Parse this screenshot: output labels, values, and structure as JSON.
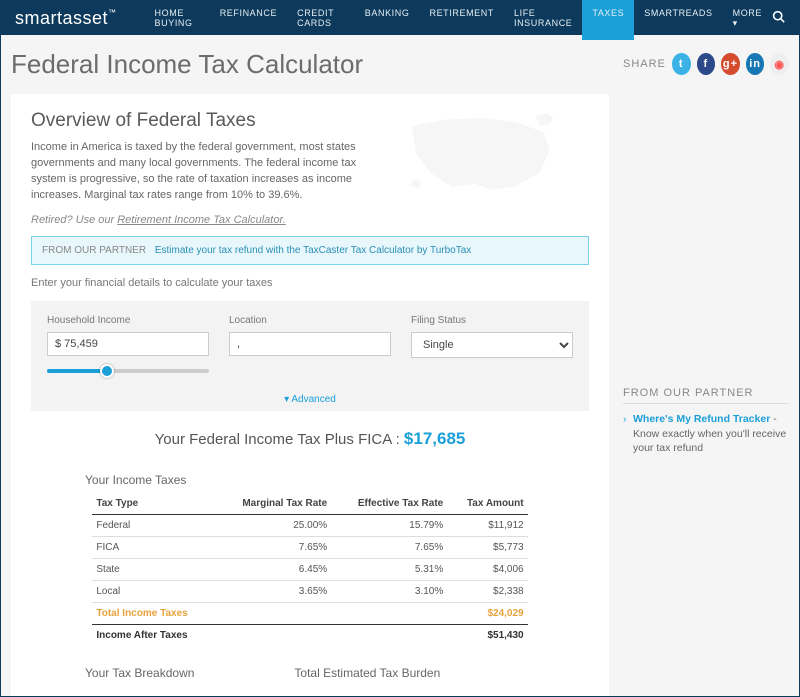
{
  "logo": {
    "a": "smart",
    "b": "asset"
  },
  "nav": [
    "HOME BUYING",
    "REFINANCE",
    "CREDIT CARDS",
    "BANKING",
    "RETIREMENT",
    "LIFE INSURANCE",
    "TAXES",
    "SMARTREADS",
    "MORE ▾"
  ],
  "title": "Federal Income Tax Calculator",
  "overview": {
    "heading": "Overview of Federal Taxes",
    "body": "Income in America is taxed by the federal government, most states governments and many local governments. The federal income tax system is progressive, so the rate of taxation increases as income increases. Marginal tax rates range from 10% to 39.6%."
  },
  "retired": {
    "pre": "Retired? Use our ",
    "link": "Retirement Income Tax Calculator."
  },
  "partner": {
    "label": "FROM OUR PARTNER",
    "text": "Estimate your tax refund with the TaxCaster Tax Calculator by TurboTax"
  },
  "prompt": "Enter your financial details to calculate your taxes",
  "fields": {
    "income_label": "Household Income",
    "income_value": "$ 75,459",
    "location_label": "Location",
    "location_value": ",",
    "filing_label": "Filing Status",
    "filing_value": "Single"
  },
  "advanced": "▾ Advanced",
  "result": {
    "text": "Your Federal Income Tax Plus FICA :",
    "amount": "$17,685"
  },
  "table": {
    "title": "Your Income Taxes",
    "headers": [
      "Tax Type",
      "Marginal Tax Rate",
      "Effective Tax Rate",
      "Tax Amount"
    ],
    "rows": [
      [
        "Federal",
        "25.00%",
        "15.79%",
        "$11,912"
      ],
      [
        "FICA",
        "7.65%",
        "7.65%",
        "$5,773"
      ],
      [
        "State",
        "6.45%",
        "5.31%",
        "$4,006"
      ],
      [
        "Local",
        "3.65%",
        "3.10%",
        "$2,338"
      ]
    ],
    "total": [
      "Total Income Taxes",
      "",
      "",
      "$24,029"
    ],
    "after": [
      "Income After Taxes",
      "",
      "",
      "$51,430"
    ]
  },
  "bottom": [
    "Your Tax Breakdown",
    "Total Estimated Tax Burden"
  ],
  "share": {
    "label": "SHARE"
  },
  "sidepartner": {
    "heading": "FROM OUR PARTNER",
    "link": "Where's My Refund Tracker",
    "rest": " - Know exactly when you'll receive your tax refund"
  }
}
